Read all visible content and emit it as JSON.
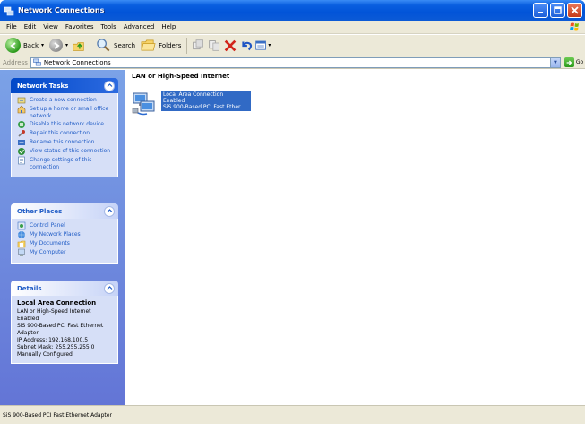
{
  "window": {
    "title": "Network Connections",
    "colors": {
      "titlebar": "#0254d8",
      "taskpane": "#6f8de0",
      "selection": "#316ac5",
      "link": "#215dc6"
    }
  },
  "menubar": {
    "items": [
      "File",
      "Edit",
      "View",
      "Favorites",
      "Tools",
      "Advanced",
      "Help"
    ]
  },
  "toolbar": {
    "back_label": "Back",
    "search_label": "Search",
    "folders_label": "Folders"
  },
  "address": {
    "label": "Address",
    "value": "Network Connections",
    "go_label": "Go"
  },
  "sidebar": {
    "network_tasks": {
      "title": "Network Tasks",
      "items": [
        {
          "label": "Create a new connection",
          "icon": "new-connection-icon"
        },
        {
          "label": "Set up a home or small office network",
          "icon": "home-network-icon"
        },
        {
          "label": "Disable this network device",
          "icon": "disable-device-icon"
        },
        {
          "label": "Repair this connection",
          "icon": "repair-icon"
        },
        {
          "label": "Rename this connection",
          "icon": "rename-icon"
        },
        {
          "label": "View status of this connection",
          "icon": "status-icon"
        },
        {
          "label": "Change settings of this connection",
          "icon": "settings-icon"
        }
      ]
    },
    "other_places": {
      "title": "Other Places",
      "items": [
        {
          "label": "Control Panel",
          "icon": "control-panel-icon"
        },
        {
          "label": "My Network Places",
          "icon": "network-places-icon"
        },
        {
          "label": "My Documents",
          "icon": "documents-icon"
        },
        {
          "label": "My Computer",
          "icon": "computer-icon"
        }
      ]
    },
    "details": {
      "title": "Details",
      "name": "Local Area Connection",
      "type": "LAN or High-Speed Internet",
      "status": "Enabled",
      "device_1": "SiS 900-Based PCI Fast Ethernet",
      "device_2": "Adapter",
      "ip": "IP Address: 192.168.100.5",
      "mask": "Subnet Mask: 255.255.255.0",
      "config": "Manually Configured"
    }
  },
  "main": {
    "group_title": "LAN or High-Speed Internet",
    "connection": {
      "name": "Local Area Connection",
      "status": "Enabled",
      "device": "SiS 900-Based PCI Fast Ether..."
    }
  },
  "statusbar": {
    "text": "SiS 900-Based PCI Fast Ethernet Adapter"
  }
}
